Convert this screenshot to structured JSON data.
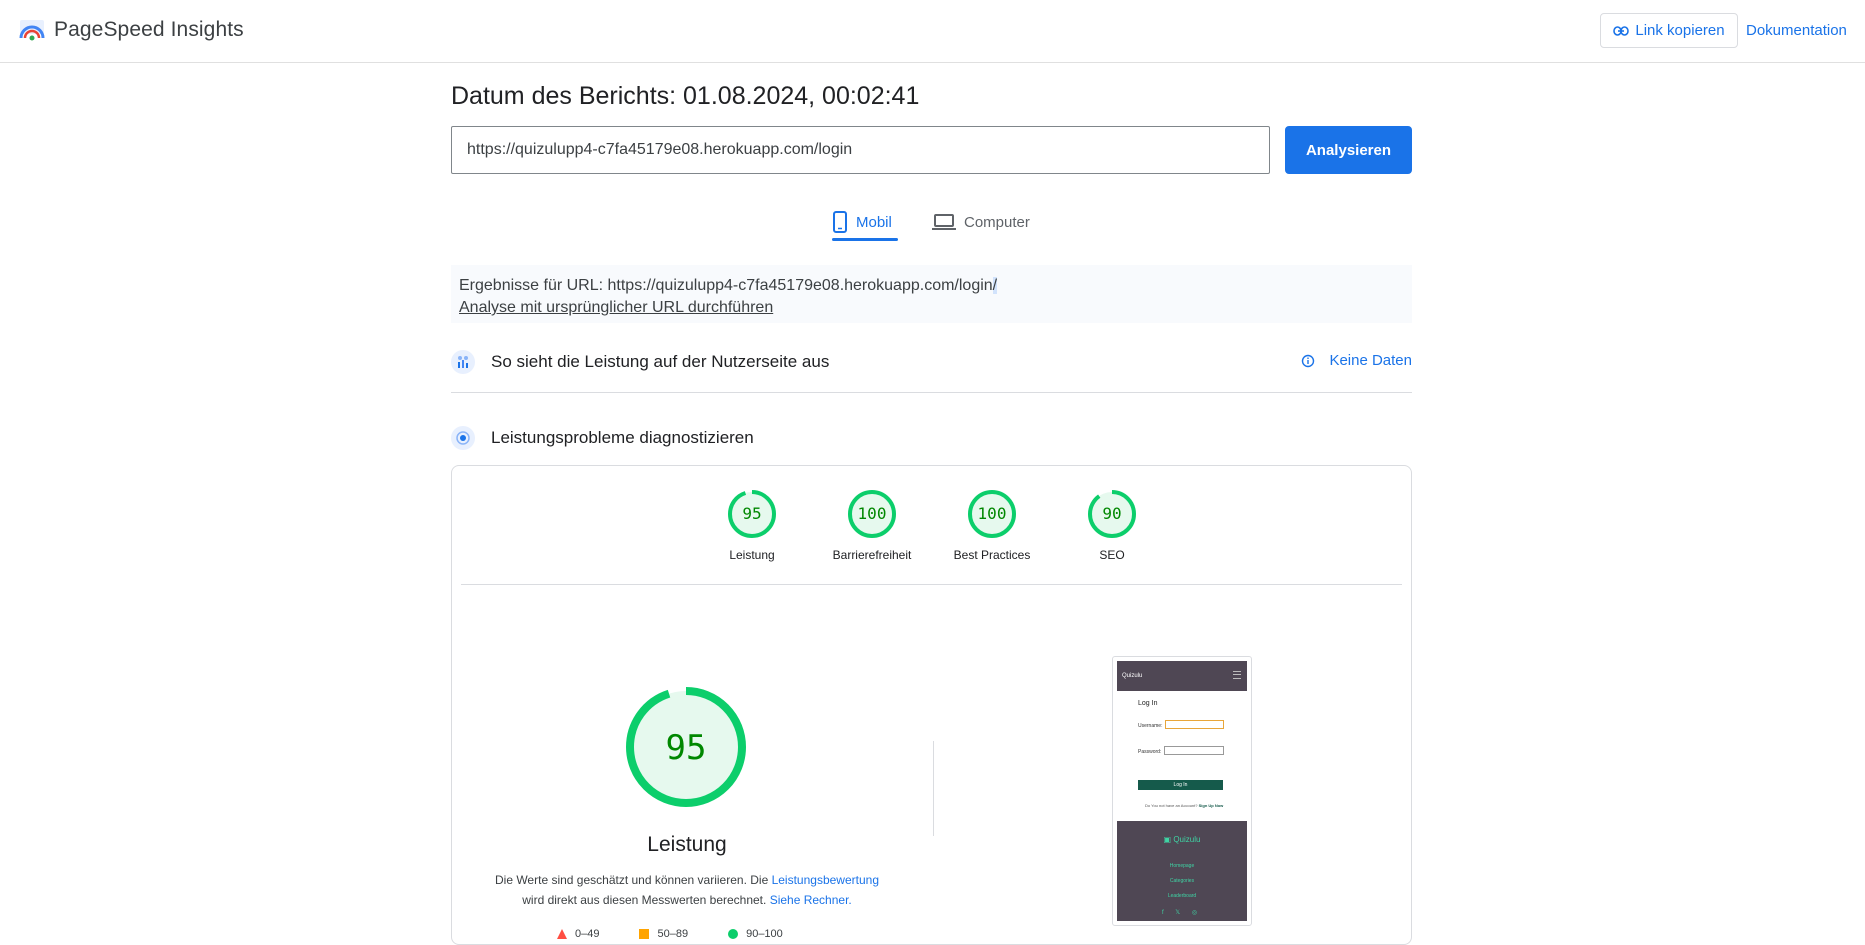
{
  "header": {
    "app_title": "PageSpeed Insights",
    "copy_link_label": "Link kopieren",
    "docs_label": "Dokumentation"
  },
  "report": {
    "date_label": "Datum des Berichts: 01.08.2024, 00:02:41",
    "url_value": "https://quizulupp4-c7fa45179e08.herokuapp.com/login",
    "analyze_label": "Analysieren"
  },
  "tabs": {
    "mobile_label": "Mobil",
    "desktop_label": "Computer",
    "active": "mobile"
  },
  "results": {
    "prefix": "Ergebnisse für URL: https://quizulupp4-c7fa45179e08.herokuapp.com/login",
    "suffix": "/",
    "rerun_link": "Analyse mit ursprünglicher URL durchführen"
  },
  "field_data": {
    "title": "So sieht die Leistung auf der Nutzerseite aus",
    "no_data_label": "Keine Daten"
  },
  "diagnose": {
    "title": "Leistungsprobleme diagnostizieren"
  },
  "scores": [
    {
      "label": "Leistung",
      "value": 95
    },
    {
      "label": "Barrierefreiheit",
      "value": 100
    },
    {
      "label": "Best Practices",
      "value": 100
    },
    {
      "label": "SEO",
      "value": 90
    }
  ],
  "performance": {
    "score": 95,
    "label": "Leistung",
    "desc_1": "Die Werte sind geschätzt und können variieren. Die ",
    "desc_link_1": "Leistungsbewertung",
    "desc_2": "wird direkt aus diesen Messwerten berechnet. ",
    "desc_link_2": "Siehe Rechner.",
    "legend": [
      "0–49",
      "50–89",
      "90–100"
    ]
  },
  "screenshot": {
    "nav_brand": "Quizulu",
    "login_title": "Log In",
    "username_label": "Username:",
    "password_label": "Password:",
    "login_button": "Log In",
    "signup_text": "Do You not have an Account?",
    "signup_link": "Sign Up Now",
    "footer_brand": "Quizulu",
    "footer_links": [
      "Homepage",
      "Categories",
      "Leaderboard"
    ],
    "footer_social": "f 𝕏 ◎"
  },
  "colors": {
    "accent": "#1a73e8",
    "pass_green": "#0cce6b",
    "pass_fill": "#e6f9ee",
    "pass_text": "#008800",
    "average_orange": "#ffa400",
    "fail_red": "#ff4e42"
  }
}
